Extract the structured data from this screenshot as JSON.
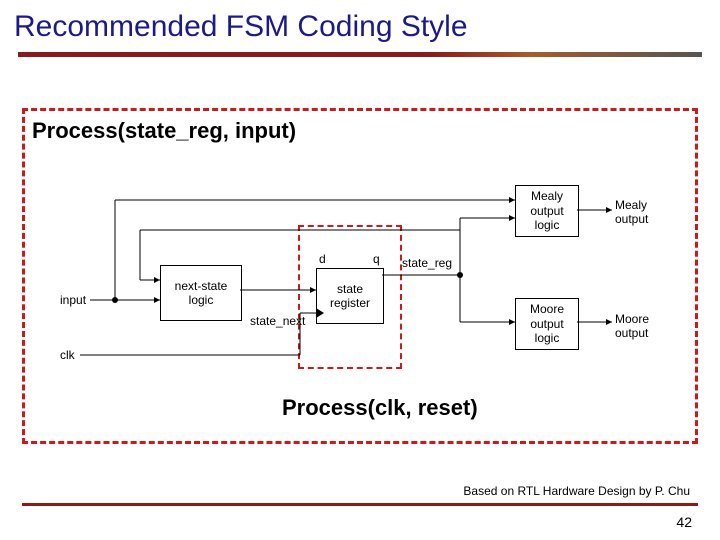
{
  "title": "Recommended FSM Coding Style",
  "proc_top": "Process(state_reg, input)",
  "proc_bot": "Process(clk, reset)",
  "blocks": {
    "nextstate": {
      "l1": "next-state",
      "l2": "logic"
    },
    "register": {
      "l1": "state",
      "l2": "register"
    },
    "mealy": {
      "l1": "Mealy",
      "l2": "output",
      "l3": "logic"
    },
    "moore": {
      "l1": "Moore",
      "l2": "output",
      "l3": "logic"
    }
  },
  "signals": {
    "input": "input",
    "clk": "clk",
    "state_next": "state_next",
    "d": "d",
    "q": "q",
    "state_reg": "state_reg",
    "mealy_out": "Mealy\noutput",
    "moore_out": "Moore\noutput"
  },
  "footer": "Based on RTL Hardware Design by P. Chu",
  "page": "42"
}
